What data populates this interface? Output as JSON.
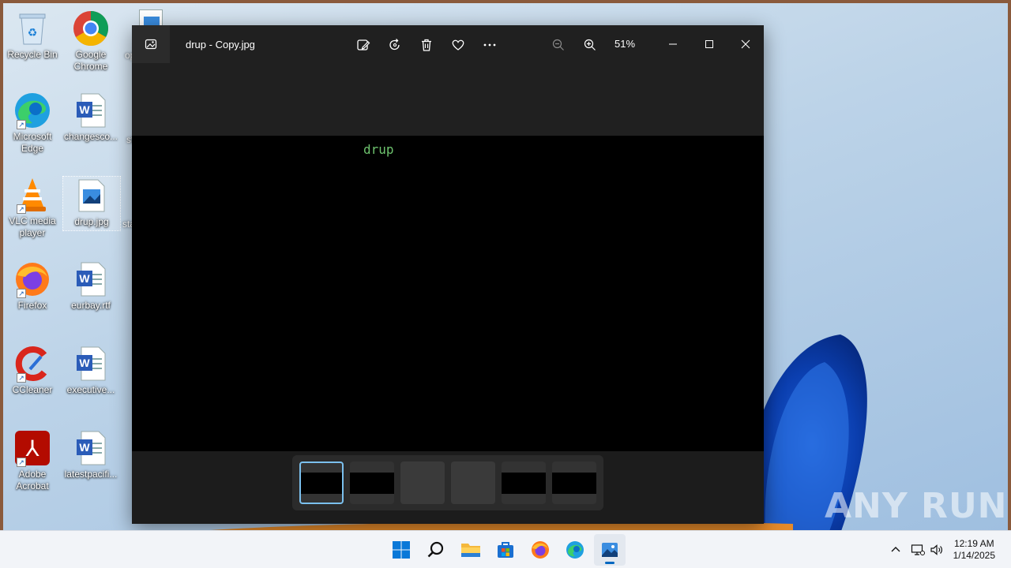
{
  "desktop": {
    "icons": [
      {
        "label": "Recycle Bin",
        "icon": "recycle-bin-icon"
      },
      {
        "label": "Google Chrome",
        "icon": "chrome-icon"
      },
      {
        "label": "Microsoft Edge",
        "icon": "edge-icon"
      },
      {
        "label": "changesco...",
        "icon": "word-document-icon"
      },
      {
        "label": "VLC media player",
        "icon": "vlc-icon"
      },
      {
        "label": "drup.jpg",
        "icon": "image-file-icon"
      },
      {
        "label": "Firefox",
        "icon": "firefox-icon"
      },
      {
        "label": "eurbay.rtf",
        "icon": "word-document-icon"
      },
      {
        "label": "CCleaner",
        "icon": "ccleaner-icon"
      },
      {
        "label": "executive...",
        "icon": "word-document-icon"
      },
      {
        "label": "Adobe Acrobat",
        "icon": "acrobat-icon"
      },
      {
        "label": "latestpacifi...",
        "icon": "word-document-icon"
      }
    ],
    "partial_labels": [
      "op",
      "st",
      "sta"
    ]
  },
  "photos_window": {
    "title": "drup - Copy.jpg",
    "zoom": "51%",
    "image_text": "drup",
    "toolbar": [
      "edit-image-icon",
      "rotate-icon",
      "delete-icon",
      "favorite-icon",
      "more-icon",
      "zoom-out-icon",
      "zoom-in-icon"
    ],
    "filmstrip": {
      "count": 6,
      "active_index": 0
    }
  },
  "watermark": "ANY RUN",
  "taskbar": {
    "apps": [
      "start-icon",
      "search-icon",
      "file-explorer-icon",
      "store-icon",
      "firefox-icon",
      "edge-icon",
      "photos-icon"
    ],
    "active_app": "photos-icon",
    "time": "12:19 AM",
    "date": "1/14/2025"
  },
  "colors": {
    "accent": "#0067c0",
    "image_text": "#6ec36e",
    "window_bg": "#202020"
  }
}
